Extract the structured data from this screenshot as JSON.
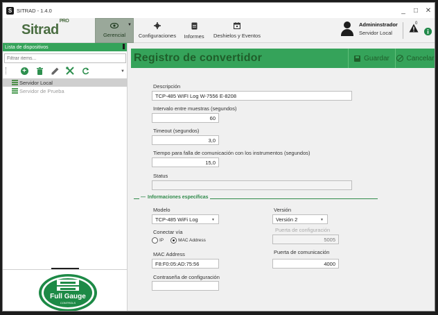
{
  "window": {
    "title": "SITRAD - 1.4.0",
    "icon_letter": "S",
    "controls": {
      "minimize": "_",
      "maximize": "□",
      "close": "✕"
    }
  },
  "header": {
    "logo_text": "Sitrad",
    "logo_sup": "PRO",
    "nav": [
      {
        "label": "Gerencial",
        "icon": "eye-icon",
        "active": true
      },
      {
        "label": "Configuraciones",
        "icon": "gear-icon"
      },
      {
        "label": "Informes",
        "icon": "document-icon"
      },
      {
        "label": "Deshielos y Eventos",
        "icon": "calendar-icon"
      }
    ],
    "user": {
      "name": "Admininstrador",
      "server": "Servidor Local"
    },
    "alert_count": "0"
  },
  "sidebar": {
    "title": "Lista de dispositivos",
    "filter_placeholder": "Filtrar items...",
    "toolbar": [
      "add-icon",
      "delete-icon",
      "edit-icon",
      "tools-icon",
      "refresh-icon"
    ],
    "items": [
      {
        "label": "Servidor Local",
        "selected": true
      },
      {
        "label": "Servidor de Prueba",
        "dim": true
      }
    ],
    "brand": "Full Gauge",
    "brand_sub": "CONTROLS"
  },
  "form": {
    "title": "Registro de convertidor",
    "save_label": "Guardar",
    "cancel_label": "Cancelar",
    "description_label": "Descripción",
    "description_value": "TCP-485 WIFI Log W-7556 E-8208",
    "interval_label": "Intervalo entre muestras (segundos)",
    "interval_value": "60",
    "timeout_label": "Timeout (segundos)",
    "timeout_value": "3,0",
    "failure_label": "Tiempo para falla de comunicación con los instrumentos (segundos)",
    "failure_value": "15,0",
    "status_label": "Status",
    "status_value": "",
    "section_title": "Informaciones específicas",
    "model_label": "Modelo",
    "model_value": "TCP-485 WiFi Log",
    "version_label": "Versión",
    "version_value": "Versión 2",
    "connect_label": "Conectar vía",
    "radio_ip": "IP",
    "radio_mac": "MAC Address",
    "config_port_label": "Puerta de configuración",
    "config_port_value": "5005",
    "mac_label": "MAC Address",
    "mac_value": "F8:F0:05:AD:75:56",
    "comm_port_label": "Puerta de comunicación",
    "comm_port_value": "4000",
    "config_password_label": "Contraseña de configuración",
    "config_password_value": ""
  },
  "colors": {
    "accent_green": "#35a35a",
    "dark_green": "#1f5e2a",
    "logo_green": "#4a6d41",
    "badge_green": "#1d8a46"
  }
}
